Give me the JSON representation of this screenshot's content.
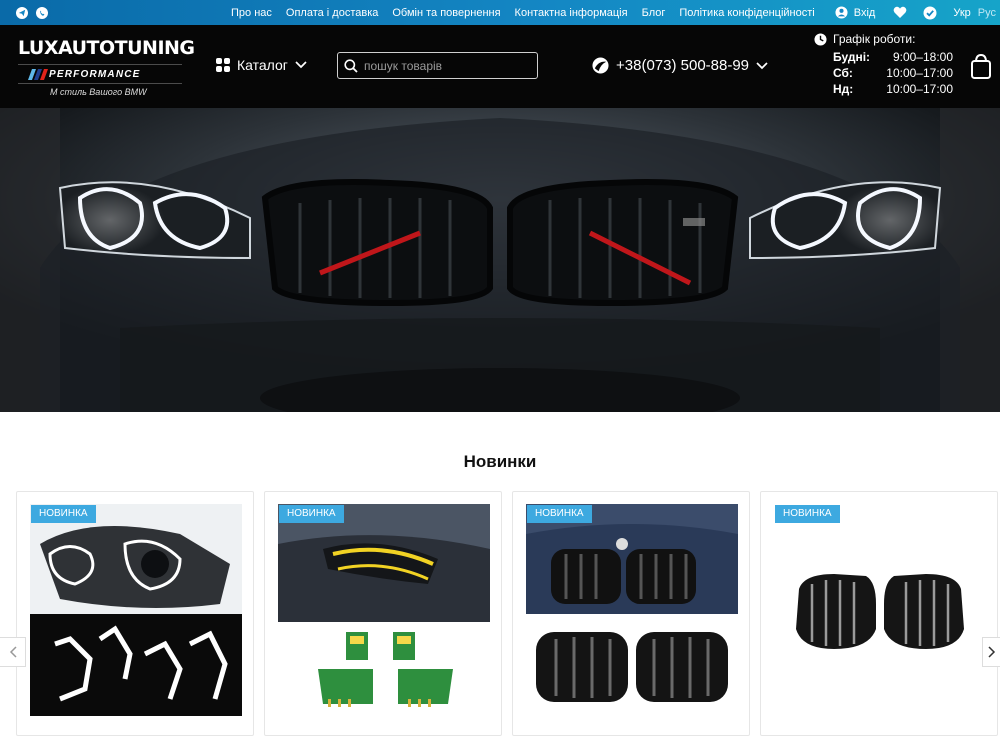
{
  "topbar": {
    "nav": [
      "Про нас",
      "Оплата і доставка",
      "Обмін та повернення",
      "Контактна інформація",
      "Блог",
      "Політика конфіденційності"
    ],
    "login": "Вхід",
    "lang_active": "Укр",
    "lang_other": "Рус"
  },
  "header": {
    "logo_title": "LUXAUTOTUNING",
    "logo_perf": "PERFORMANCE",
    "logo_tagline": "M стиль Вашого BMW",
    "catalog": "Каталог",
    "search_placeholder": "пошук товарів",
    "phone": "+38(073) 500-88-99",
    "schedule": {
      "title": "Графік роботи:",
      "rows": [
        {
          "day": "Будні:",
          "hours": "9:00–18:00"
        },
        {
          "day": "Сб:",
          "hours": "10:00–17:00"
        },
        {
          "day": "Нд:",
          "hours": "10:00–17:00"
        }
      ]
    }
  },
  "section": {
    "title": "Новинки"
  },
  "products": [
    {
      "badge": "НОВИНКА"
    },
    {
      "badge": "НОВИНКА"
    },
    {
      "badge": "НОВИНКА"
    },
    {
      "badge": "НОВИНКА"
    }
  ],
  "colors": {
    "topbar_start": "#0a6aa8",
    "topbar_end": "#16a4c9",
    "header_bg": "#060606",
    "badge_bg": "#3da9e0",
    "m_blue_light": "#5fb8e8",
    "m_blue_dark": "#1f3f8f",
    "m_red": "#e2231a"
  }
}
